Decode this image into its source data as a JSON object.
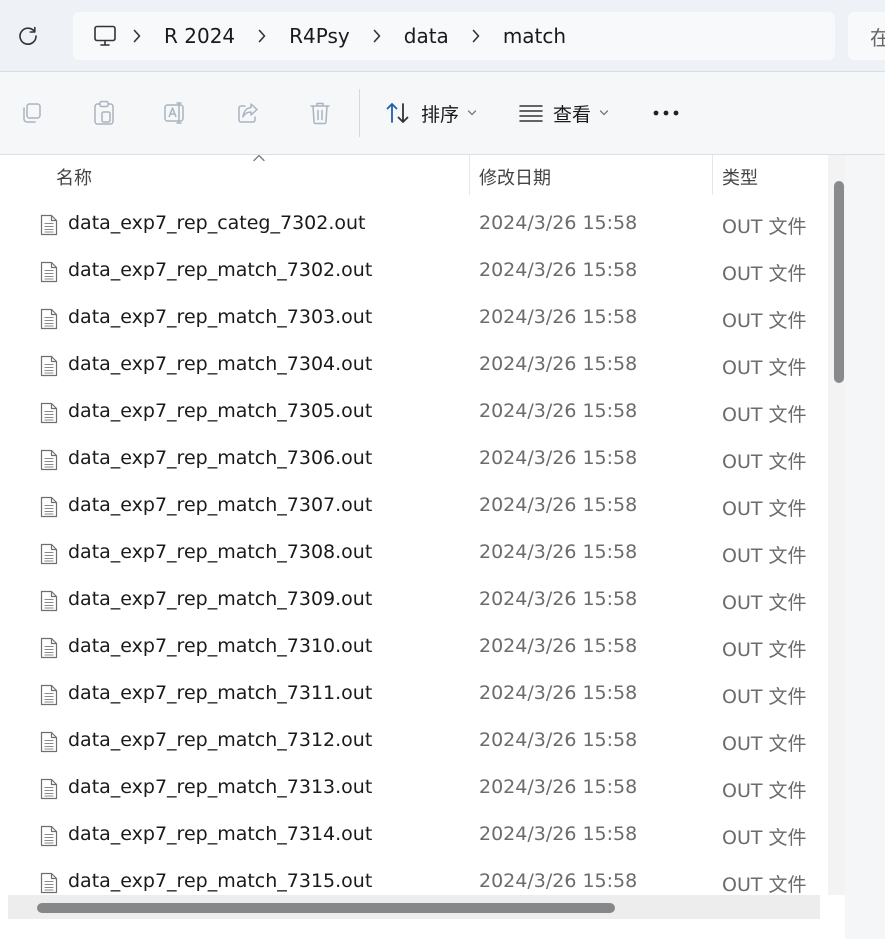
{
  "address_bar": {
    "refresh_icon": "refresh-icon",
    "root_icon": "monitor-icon",
    "breadcrumb": [
      "R 2024",
      "R4Psy",
      "data",
      "match"
    ],
    "search_placeholder": "在"
  },
  "toolbar": {
    "buttons": [
      "copy-icon",
      "paste-icon",
      "rename-icon",
      "share-icon",
      "delete-icon"
    ],
    "sort_label": "排序",
    "view_label": "查看",
    "more_icon": "more-icon"
  },
  "columns": {
    "name": "名称",
    "date": "修改日期",
    "type": "类型"
  },
  "files": [
    {
      "name": "data_exp7_rep_categ_7302.out",
      "date": "2024/3/26 15:58",
      "type": "OUT 文件"
    },
    {
      "name": "data_exp7_rep_match_7302.out",
      "date": "2024/3/26 15:58",
      "type": "OUT 文件"
    },
    {
      "name": "data_exp7_rep_match_7303.out",
      "date": "2024/3/26 15:58",
      "type": "OUT 文件"
    },
    {
      "name": "data_exp7_rep_match_7304.out",
      "date": "2024/3/26 15:58",
      "type": "OUT 文件"
    },
    {
      "name": "data_exp7_rep_match_7305.out",
      "date": "2024/3/26 15:58",
      "type": "OUT 文件"
    },
    {
      "name": "data_exp7_rep_match_7306.out",
      "date": "2024/3/26 15:58",
      "type": "OUT 文件"
    },
    {
      "name": "data_exp7_rep_match_7307.out",
      "date": "2024/3/26 15:58",
      "type": "OUT 文件"
    },
    {
      "name": "data_exp7_rep_match_7308.out",
      "date": "2024/3/26 15:58",
      "type": "OUT 文件"
    },
    {
      "name": "data_exp7_rep_match_7309.out",
      "date": "2024/3/26 15:58",
      "type": "OUT 文件"
    },
    {
      "name": "data_exp7_rep_match_7310.out",
      "date": "2024/3/26 15:58",
      "type": "OUT 文件"
    },
    {
      "name": "data_exp7_rep_match_7311.out",
      "date": "2024/3/26 15:58",
      "type": "OUT 文件"
    },
    {
      "name": "data_exp7_rep_match_7312.out",
      "date": "2024/3/26 15:58",
      "type": "OUT 文件"
    },
    {
      "name": "data_exp7_rep_match_7313.out",
      "date": "2024/3/26 15:58",
      "type": "OUT 文件"
    },
    {
      "name": "data_exp7_rep_match_7314.out",
      "date": "2024/3/26 15:58",
      "type": "OUT 文件"
    },
    {
      "name": "data_exp7_rep_match_7315.out",
      "date": "2024/3/26 15:58",
      "type": "OUT 文件"
    }
  ]
}
